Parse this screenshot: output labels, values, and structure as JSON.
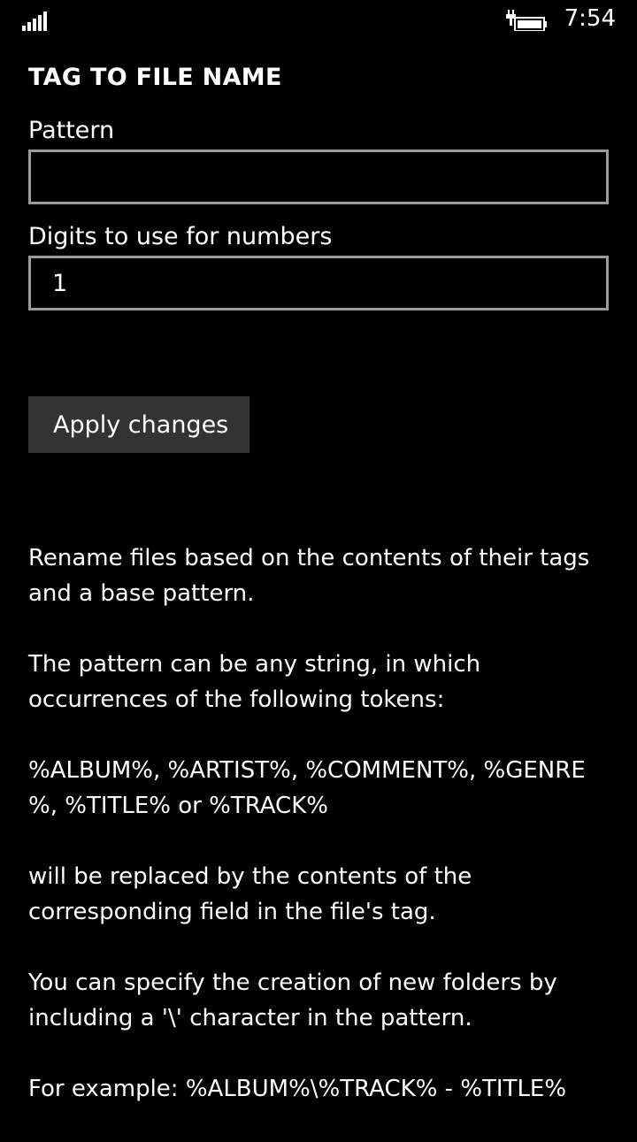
{
  "status_bar": {
    "time": "7:54",
    "signal_bars": 5,
    "battery_charging": true
  },
  "page": {
    "title": "TAG TO FILE NAME",
    "pattern_label": "Pattern",
    "pattern_value": "",
    "digits_label": "Digits to use for numbers",
    "digits_value": "1",
    "apply_button": "Apply changes"
  },
  "description": {
    "p1": "Rename files based on the contents of their tags\nand a base pattern.",
    "p2": "The pattern can be any string, in which\noccurrences of the following tokens:",
    "p3": "%ALBUM%, %ARTIST%, %COMMENT%, %GENRE\n%, %TITLE% or %TRACK%",
    "p4": "will be replaced by the contents of the\ncorresponding field in the file's tag.",
    "p5": "You can specify the creation of new folders by\nincluding a '\\' character in the pattern.",
    "p6": "For example: %ALBUM%\\%TRACK% - %TITLE%"
  },
  "colors": {
    "background": "#000000",
    "text": "#ffffff",
    "field_border": "#9b9b9b",
    "button_bg": "#333333"
  }
}
